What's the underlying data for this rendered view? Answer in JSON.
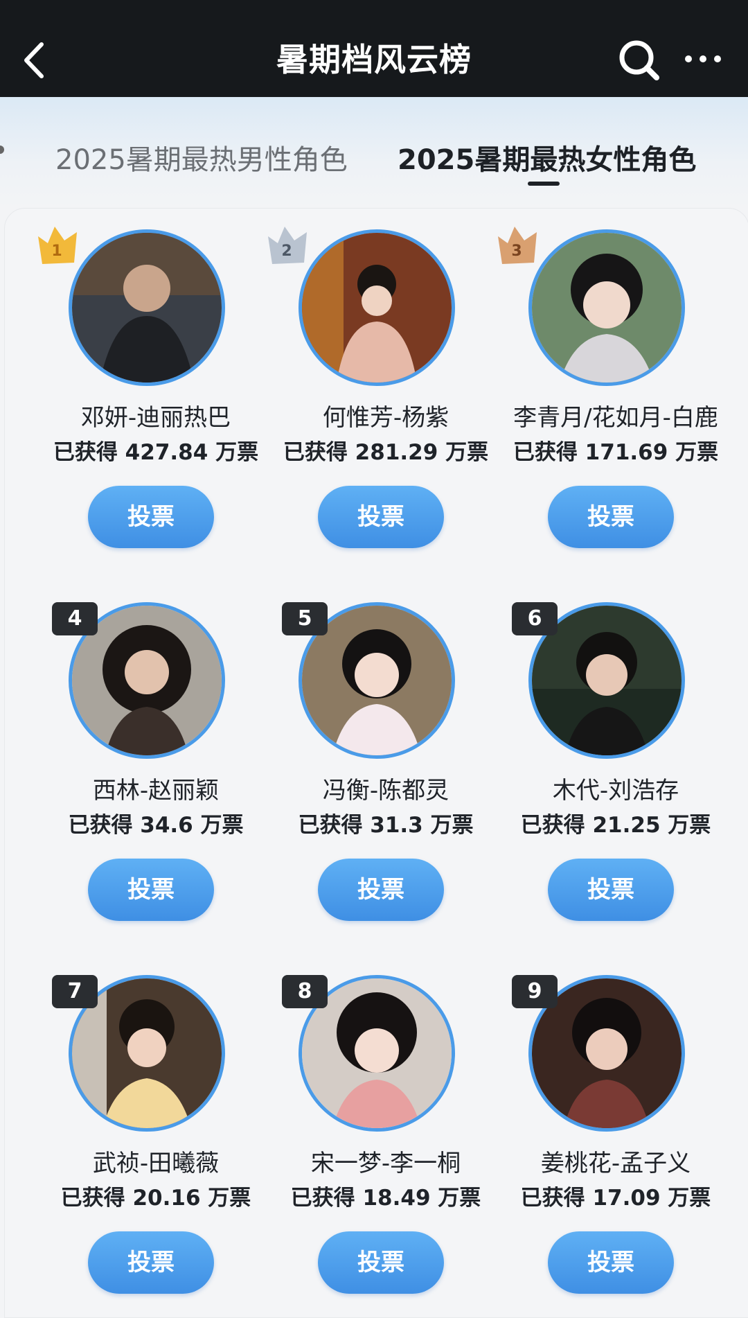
{
  "header": {
    "title": "暑期档风云榜",
    "back_icon": "chevron-left-icon",
    "search_icon": "search-icon",
    "more_icon": "more-horizontal-icon"
  },
  "tabs": [
    {
      "label": "2025暑期最热男性角色",
      "active": false
    },
    {
      "label": "2025暑期最热女性角色",
      "active": true
    }
  ],
  "colors": {
    "accent": "#4a9be8",
    "topbar": "#16191c",
    "gold": "#f2b93a",
    "silver": "#b9c3d0",
    "bronze": "#d9a070"
  },
  "vote_label": "投票",
  "entries": [
    {
      "rank": "1",
      "name": "邓妍-迪丽热巴",
      "votes": "已获得 427.84 万票"
    },
    {
      "rank": "2",
      "name": "何惟芳-杨紫",
      "votes": "已获得 281.29 万票"
    },
    {
      "rank": "3",
      "name": "李青月/花如月-白鹿",
      "votes": "已获得 171.69 万票"
    },
    {
      "rank": "4",
      "name": "西林-赵丽颖",
      "votes": "已获得 34.6 万票"
    },
    {
      "rank": "5",
      "name": "冯衡-陈都灵",
      "votes": "已获得 31.3 万票"
    },
    {
      "rank": "6",
      "name": "木代-刘浩存",
      "votes": "已获得 21.25 万票"
    },
    {
      "rank": "7",
      "name": "武祯-田曦薇",
      "votes": "已获得 20.16 万票"
    },
    {
      "rank": "8",
      "name": "宋一梦-李一桐",
      "votes": "已获得 18.49 万票"
    },
    {
      "rank": "9",
      "name": "姜桃花-孟子义",
      "votes": "已获得 17.09 万票"
    }
  ]
}
